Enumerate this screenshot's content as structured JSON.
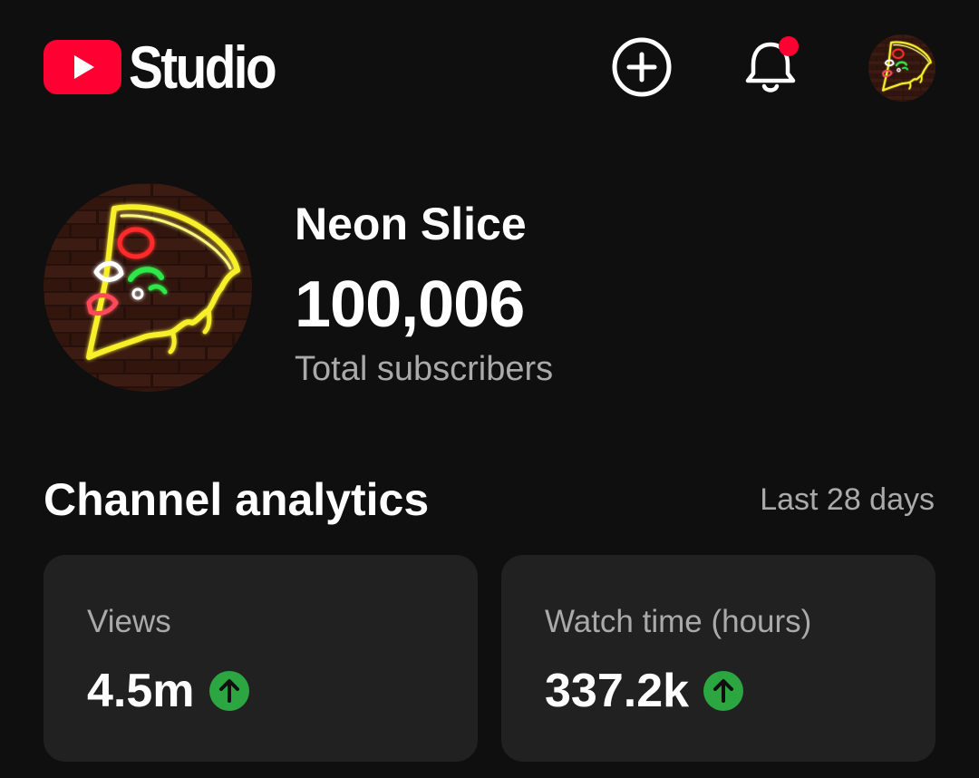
{
  "app": {
    "logo_text": "Studio",
    "brand_color": "#ff0033",
    "background": "#0f0f0f"
  },
  "header": {
    "icons": [
      "youtube-play-icon",
      "create-plus-icon",
      "notifications-bell-icon",
      "account-avatar"
    ],
    "has_unread_notifications": true
  },
  "channel": {
    "name": "Neon Slice",
    "subscribers": "100,006",
    "subscribers_label": "Total subscribers"
  },
  "analytics": {
    "title": "Channel analytics",
    "period": "Last 28 days",
    "metrics": [
      {
        "label": "Views",
        "value": "4.5m",
        "trend": "up",
        "trend_color": "#2ba640"
      },
      {
        "label": "Watch time (hours)",
        "value": "337.2k",
        "trend": "up",
        "trend_color": "#2ba640"
      }
    ]
  }
}
